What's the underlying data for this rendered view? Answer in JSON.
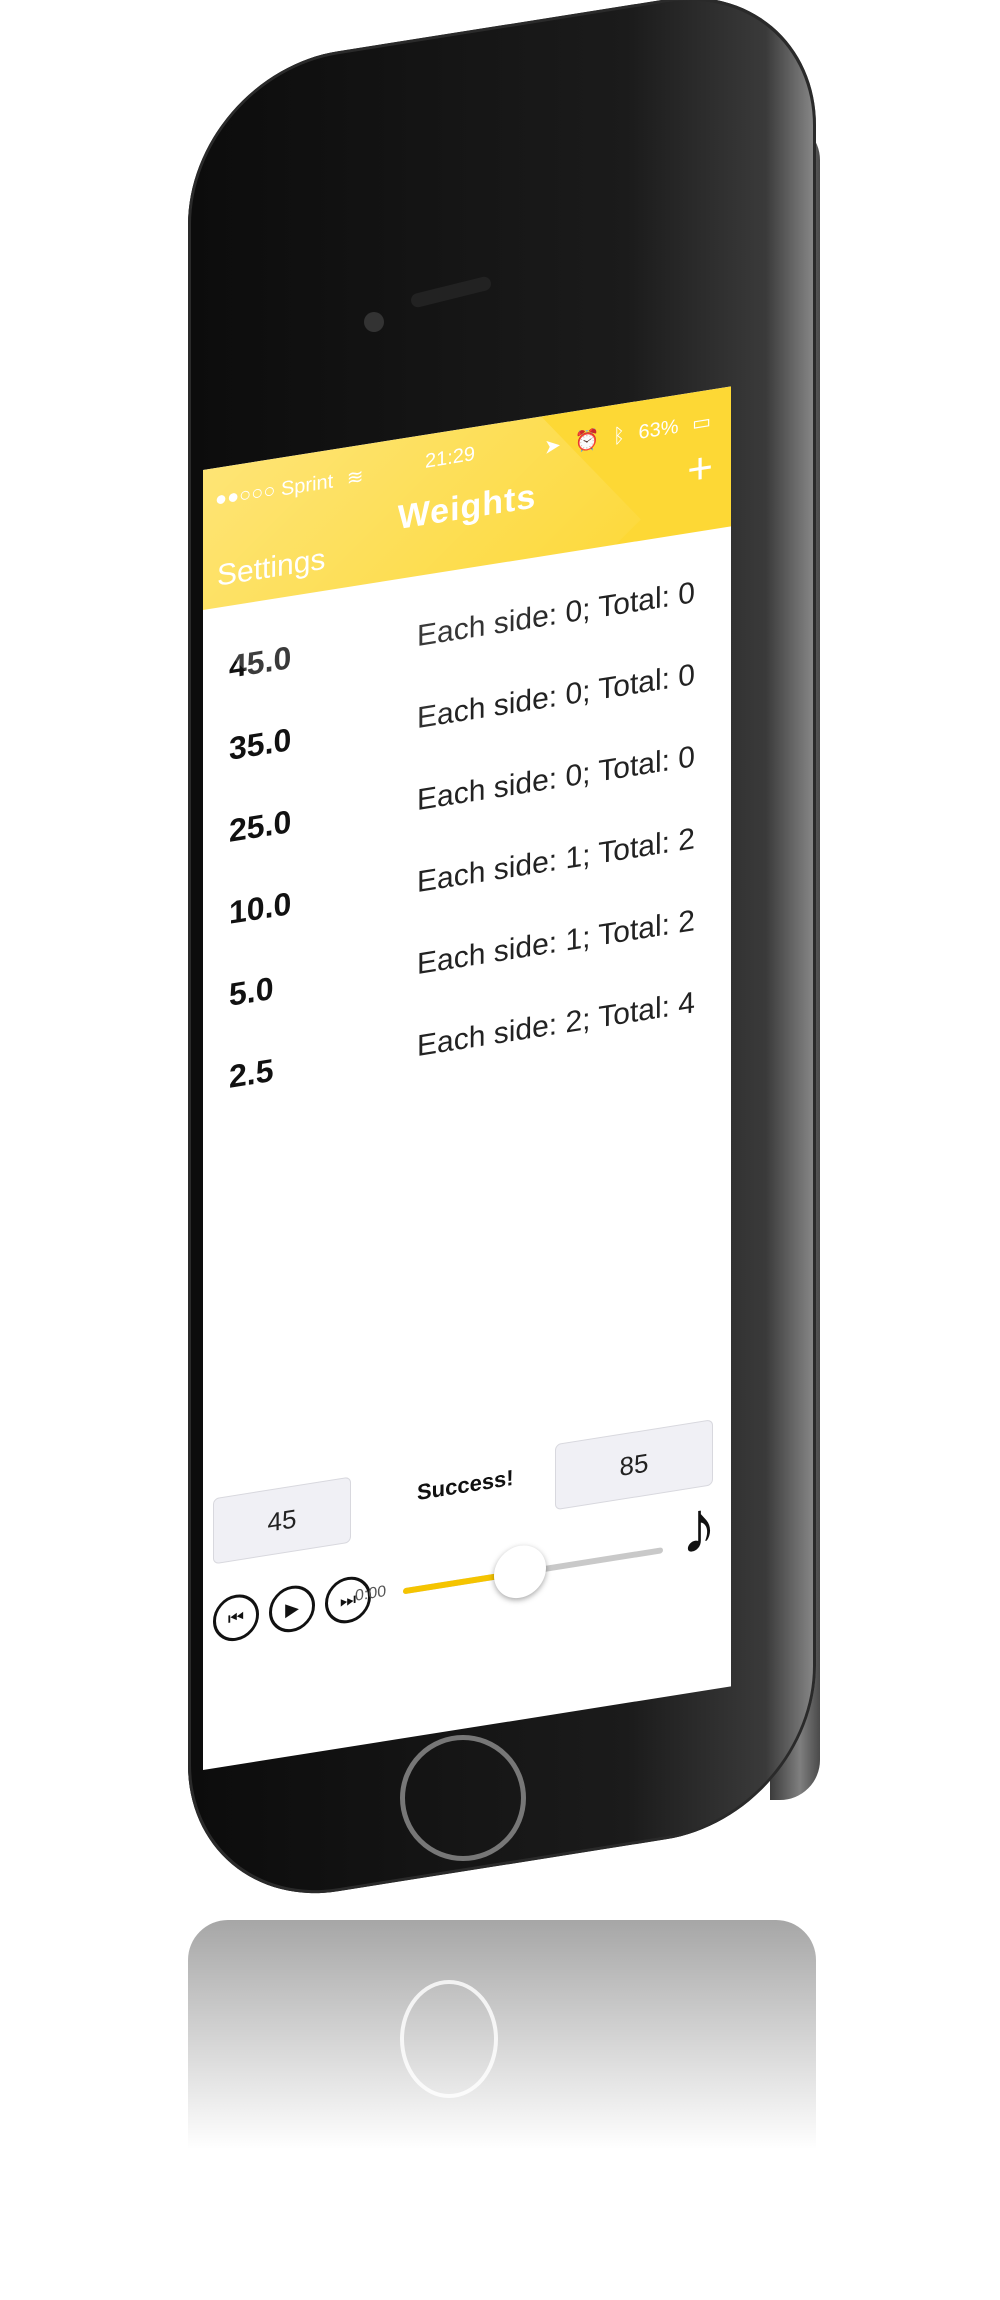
{
  "status_bar": {
    "carrier": "●●○○○ Sprint",
    "wifi_icon": "wifi-icon",
    "time": "21:29",
    "battery": "63%",
    "location_icon": "location-icon",
    "alarm_icon": "alarm-icon",
    "bluetooth_icon": "bluetooth-icon"
  },
  "navbar": {
    "title": "Weights",
    "left_button": "Settings",
    "right_button": "+"
  },
  "rows": [
    {
      "weight": "45.0",
      "detail": "Each side: 0; Total: 0"
    },
    {
      "weight": "35.0",
      "detail": "Each side: 0; Total: 0"
    },
    {
      "weight": "25.0",
      "detail": "Each side: 0; Total: 0"
    },
    {
      "weight": "10.0",
      "detail": "Each side: 1; Total: 2"
    },
    {
      "weight": "5.0",
      "detail": "Each side: 1; Total: 2"
    },
    {
      "weight": "2.5",
      "detail": "Each side: 2; Total: 4"
    }
  ],
  "bottom": {
    "left_field": "45",
    "status": "Success!",
    "right_field": "85",
    "time": "0:00",
    "slider_value": 0.45
  },
  "colors": {
    "accent": "#fdd835",
    "slider_fill": "#f5c400"
  }
}
